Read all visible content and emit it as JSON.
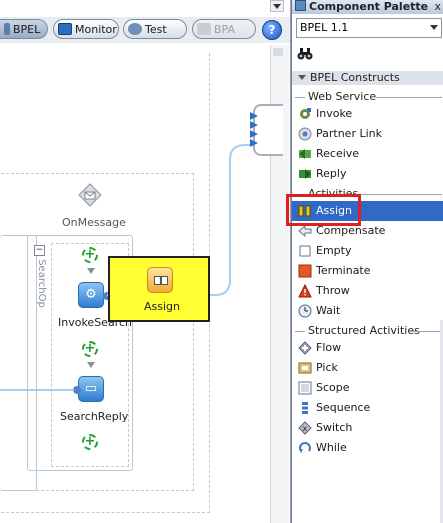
{
  "toolbar": {
    "bpel": "BPEL",
    "monitor": "Monitor",
    "test": "Test",
    "bpa": "BPA",
    "help": "?"
  },
  "diagram": {
    "on_message": "OnMessage",
    "scope_label": "SearchOp",
    "invoke": "InvokeSearch",
    "reply": "SearchReply",
    "assign": "Assign",
    "collapse_glyph": "−"
  },
  "palette": {
    "title": "Component Palette",
    "close": "x",
    "selected_value": "BPEL 1.1",
    "section": "BPEL Constructs",
    "groups": {
      "web_service": "Web Service",
      "activities": "Activities",
      "structured": "Structured Activities"
    },
    "web_service_items": [
      {
        "label": "Invoke",
        "icon": "invoke-icon"
      },
      {
        "label": "Partner Link",
        "icon": "partner-link-icon"
      },
      {
        "label": "Receive",
        "icon": "receive-icon"
      },
      {
        "label": "Reply",
        "icon": "reply-icon"
      }
    ],
    "activity_items": [
      {
        "label": "Assign",
        "icon": "assign-icon"
      },
      {
        "label": "Compensate",
        "icon": "compensate-icon"
      },
      {
        "label": "Empty",
        "icon": "empty-icon"
      },
      {
        "label": "Terminate",
        "icon": "terminate-icon"
      },
      {
        "label": "Throw",
        "icon": "throw-icon"
      },
      {
        "label": "Wait",
        "icon": "wait-icon"
      }
    ],
    "structured_items": [
      {
        "label": "Flow",
        "icon": "flow-icon"
      },
      {
        "label": "Pick",
        "icon": "pick-icon"
      },
      {
        "label": "Scope",
        "icon": "scope-icon"
      },
      {
        "label": "Sequence",
        "icon": "sequence-icon"
      },
      {
        "label": "Switch",
        "icon": "switch-icon"
      },
      {
        "label": "While",
        "icon": "while-icon"
      }
    ]
  },
  "colors": {
    "selection": "#3169c6",
    "highlight_box": "#e02020",
    "assign_drag_bg": "#ffff33",
    "connector": "#a8cdee"
  }
}
